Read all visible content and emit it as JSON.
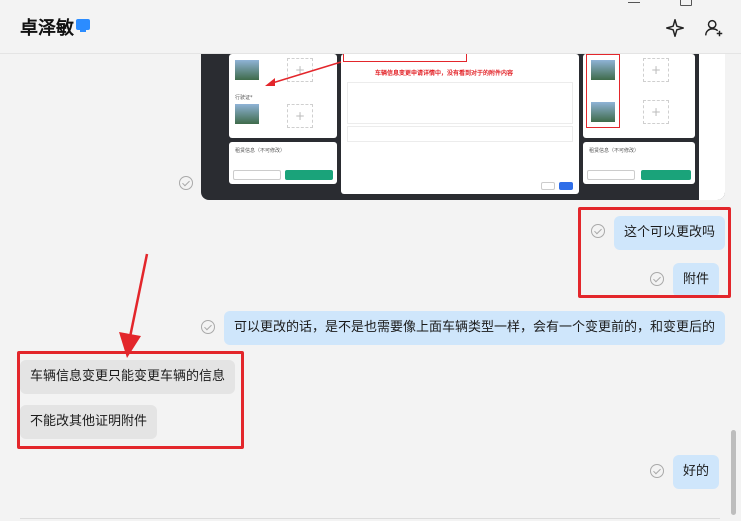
{
  "header": {
    "title": "卓泽敏",
    "icons": [
      "monitor-icon",
      "sparkle-icon",
      "add-user-icon",
      "minimize-icon",
      "maximize-icon"
    ]
  },
  "screenshot": {
    "annotation": "车辆信息变更申请详情中，没有看到对于的附件内容",
    "button_cancel": "取消",
    "button_submit": "提交",
    "panel_label_left": "租赁信息（不可修改）",
    "panel_label_right": "租赁信息（不可修改）",
    "field_label": "行驶证*"
  },
  "messages": [
    {
      "id": "m1",
      "side": "me",
      "text": "这个可以更改吗"
    },
    {
      "id": "m2",
      "side": "me",
      "text": "附件"
    },
    {
      "id": "m3",
      "side": "me",
      "text": "可以更改的话，是不是也需要像上面车辆类型一样，会有一个变更前的，和变更后的"
    },
    {
      "id": "m4",
      "side": "other",
      "text": "车辆信息变更只能变更车辆的信息"
    },
    {
      "id": "m5",
      "side": "other",
      "text": "不能改其他证明附件"
    },
    {
      "id": "m6",
      "side": "me",
      "text": "好的"
    }
  ],
  "colors": {
    "my_bubble": "#cfe6fb",
    "other_bubble": "#e4e4e4",
    "highlight": "#e3262b",
    "background": "#f3f3f3"
  }
}
